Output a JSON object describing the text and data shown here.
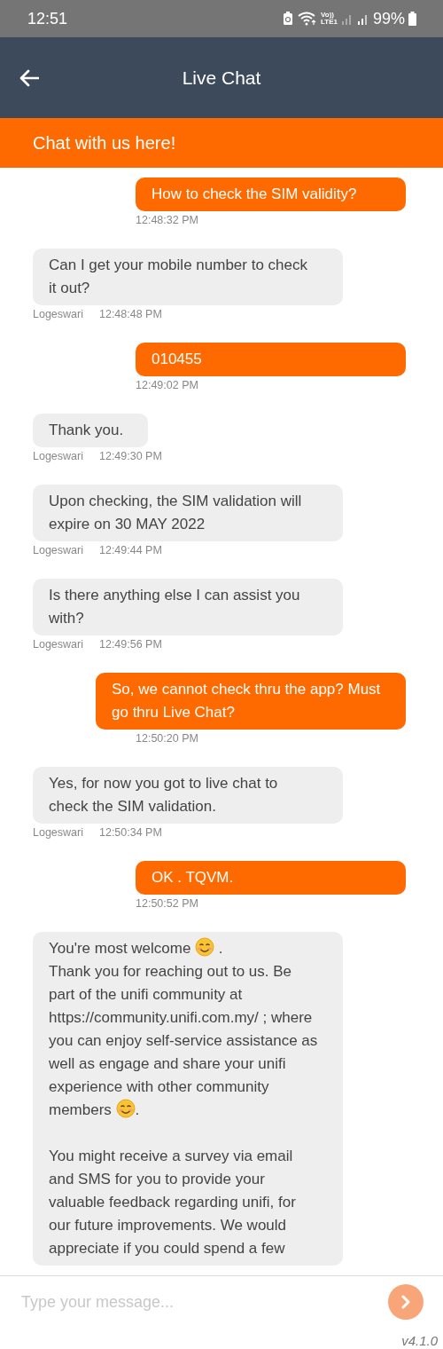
{
  "status_bar": {
    "time": "12:51",
    "network": "Vo))\nLTE1",
    "battery": "99%"
  },
  "header": {
    "title": "Live Chat"
  },
  "banner": {
    "text": "Chat with us here!"
  },
  "messages": [
    {
      "kind": "user",
      "text": "How to check the SIM validity?",
      "time": "12:48:32 PM"
    },
    {
      "kind": "agent",
      "text": "Can I get your mobile number to check it out?",
      "agent": "Logeswari",
      "time": "12:48:48 PM"
    },
    {
      "kind": "user",
      "text": "010455",
      "time": "12:49:02 PM"
    },
    {
      "kind": "agent",
      "text": "Thank you.",
      "agent": "Logeswari",
      "time": "12:49:30 PM"
    },
    {
      "kind": "agent",
      "text": "Upon checking, the SIM validation will expire on 30 MAY 2022",
      "agent": "Logeswari",
      "time": "12:49:44 PM"
    },
    {
      "kind": "agent",
      "text": "Is there anything else I can assist you with?",
      "agent": "Logeswari",
      "time": "12:49:56 PM"
    },
    {
      "kind": "user",
      "text": "So, we cannot check thru the app? Must go thru Live Chat?",
      "time": "12:50:20 PM"
    },
    {
      "kind": "agent",
      "text": "Yes, for now you got to live chat to check the SIM validation.",
      "agent": "Logeswari",
      "time": "12:50:34 PM"
    },
    {
      "kind": "user",
      "text": "OK . TQVM.",
      "time": "12:50:52 PM"
    },
    {
      "kind": "agent",
      "parts": [
        {
          "kind": "text",
          "text": "You're most welcome "
        },
        {
          "kind": "emoji"
        },
        {
          "kind": "text",
          "text": " ."
        },
        {
          "kind": "break"
        },
        {
          "kind": "text",
          "text": "Thank you for reaching out to us. Be part of the unifi community at https://community.unifi.com.my/ ; where you can enjoy self-service assistance as well as engage and share your unifi experience with other community members "
        },
        {
          "kind": "emoji"
        },
        {
          "kind": "text",
          "text": "."
        },
        {
          "kind": "break"
        },
        {
          "kind": "break"
        },
        {
          "kind": "text",
          "text": "You might receive a survey via email and SMS for you to provide your valuable feedback regarding unifi, for our future improvements. We would appreciate if you could spend a few"
        }
      ]
    }
  ],
  "composer": {
    "placeholder": "Type your message..."
  },
  "version": "v4.1.0"
}
